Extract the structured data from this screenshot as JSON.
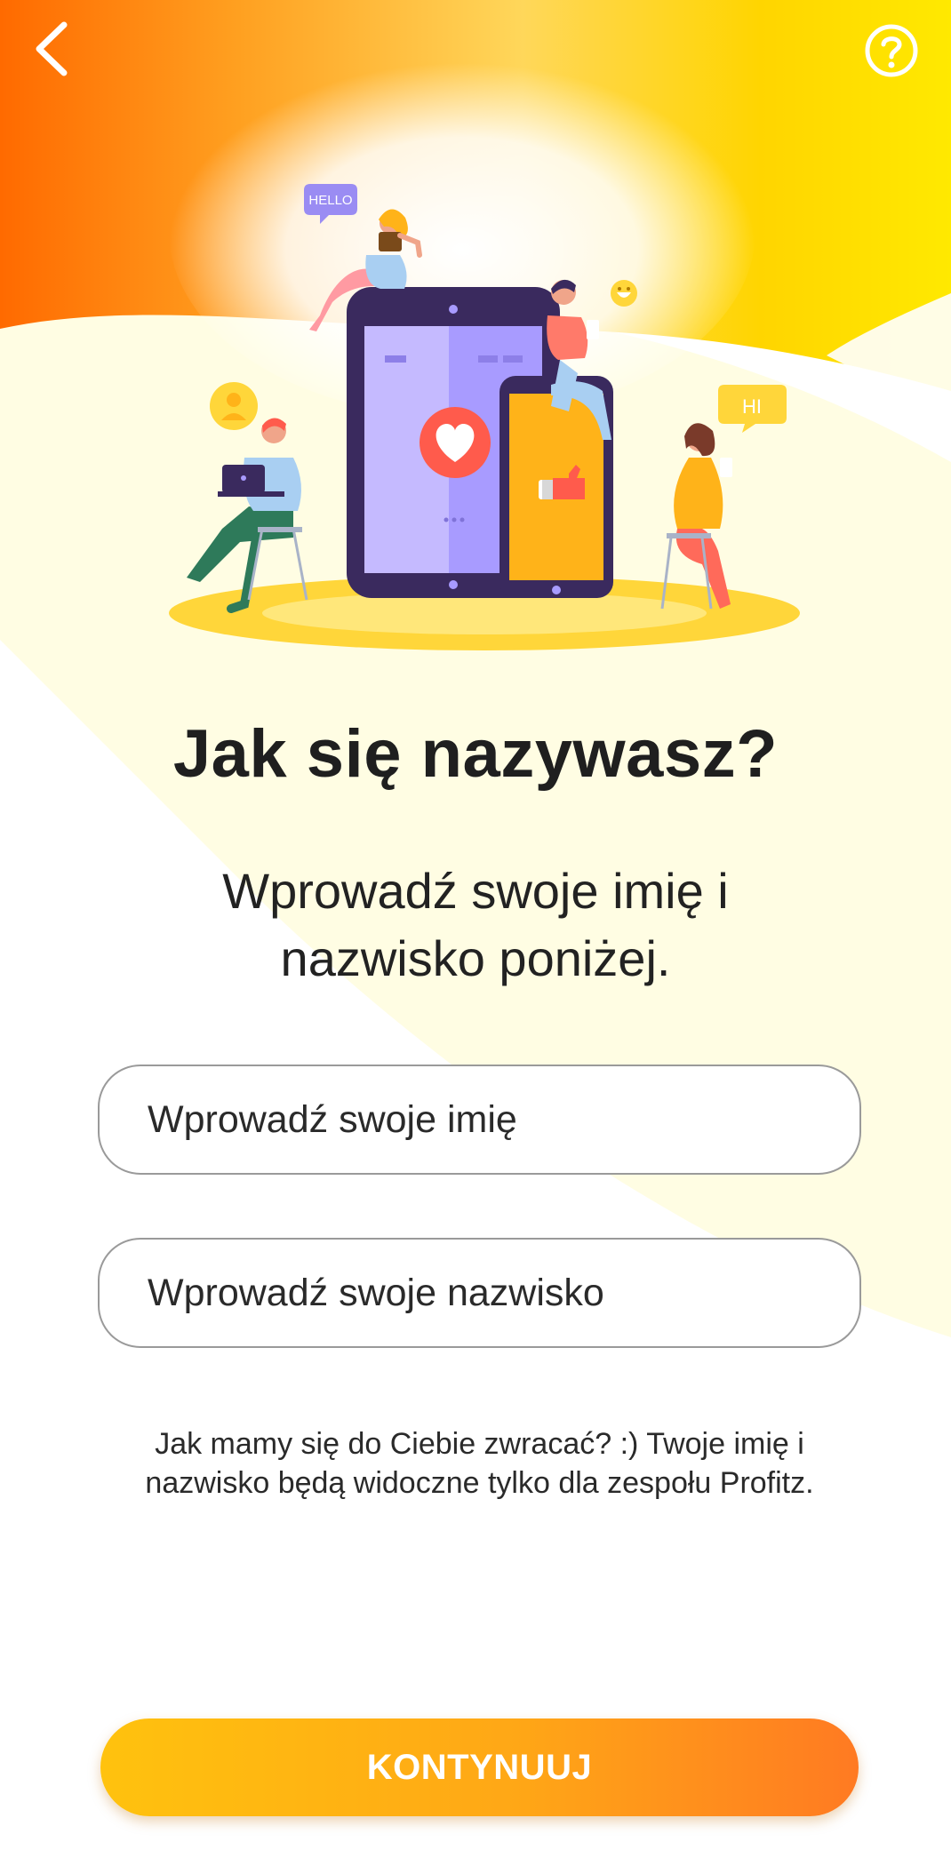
{
  "header": {
    "back_icon": "chevron-left-icon",
    "help_icon": "question-circle-icon"
  },
  "hero": {
    "bubble_hello": "HELLO",
    "bubble_hi": "HI"
  },
  "main": {
    "title": "Jak się nazywasz?",
    "subtitle": "Wprowadź swoje imię i nazwisko poniżej."
  },
  "form": {
    "first_name": {
      "value": "",
      "placeholder": "Wprowadź swoje imię"
    },
    "last_name": {
      "value": "",
      "placeholder": "Wprowadź swoje nazwisko"
    }
  },
  "note": "Jak mamy się do Ciebie zwracać? :) Twoje imię i nazwisko będą widoczne tylko dla zespołu Profitz.",
  "actions": {
    "continue_label": "KONTYNUUJ"
  },
  "colors": {
    "accent_orange": "#ff7a00",
    "accent_yellow": "#ffe500",
    "pale_yellow": "#fffde3",
    "button_start": "#ffc20e",
    "button_end": "#ff7a22"
  }
}
